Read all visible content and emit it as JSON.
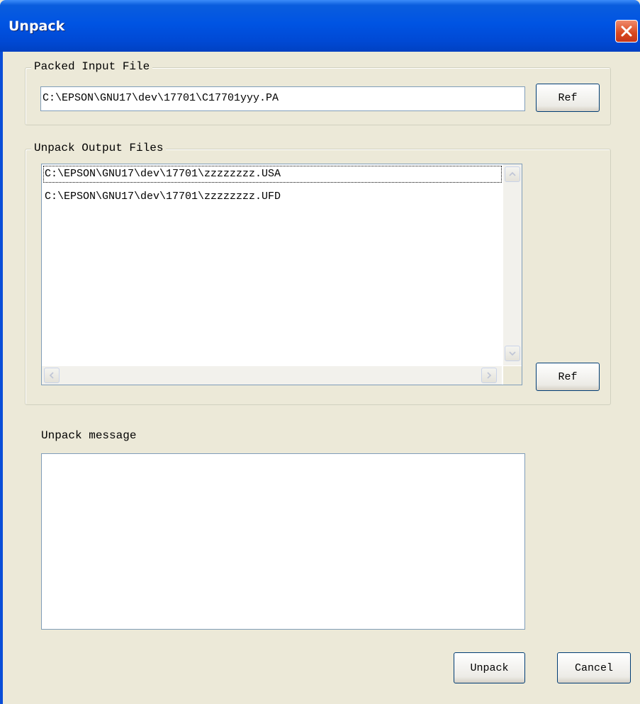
{
  "window": {
    "title": "Unpack"
  },
  "packed_input": {
    "legend": "Packed Input File",
    "path_value": "C:\\EPSON\\GNU17\\dev\\17701\\C17701yyy.PA",
    "ref_label": "Ref"
  },
  "unpack_output": {
    "legend": "Unpack Output Files",
    "files": [
      "C:\\EPSON\\GNU17\\dev\\17701\\zzzzzzzz.USA",
      "C:\\EPSON\\GNU17\\dev\\17701\\zzzzzzzz.UFD"
    ],
    "ref_label": "Ref"
  },
  "message": {
    "label": "Unpack message",
    "value": ""
  },
  "footer": {
    "unpack_label": "Unpack",
    "cancel_label": "Cancel"
  },
  "icons": {
    "close": "close-icon",
    "up": "chevron-up-icon",
    "down": "chevron-down-icon",
    "left": "chevron-left-icon",
    "right": "chevron-right-icon"
  }
}
